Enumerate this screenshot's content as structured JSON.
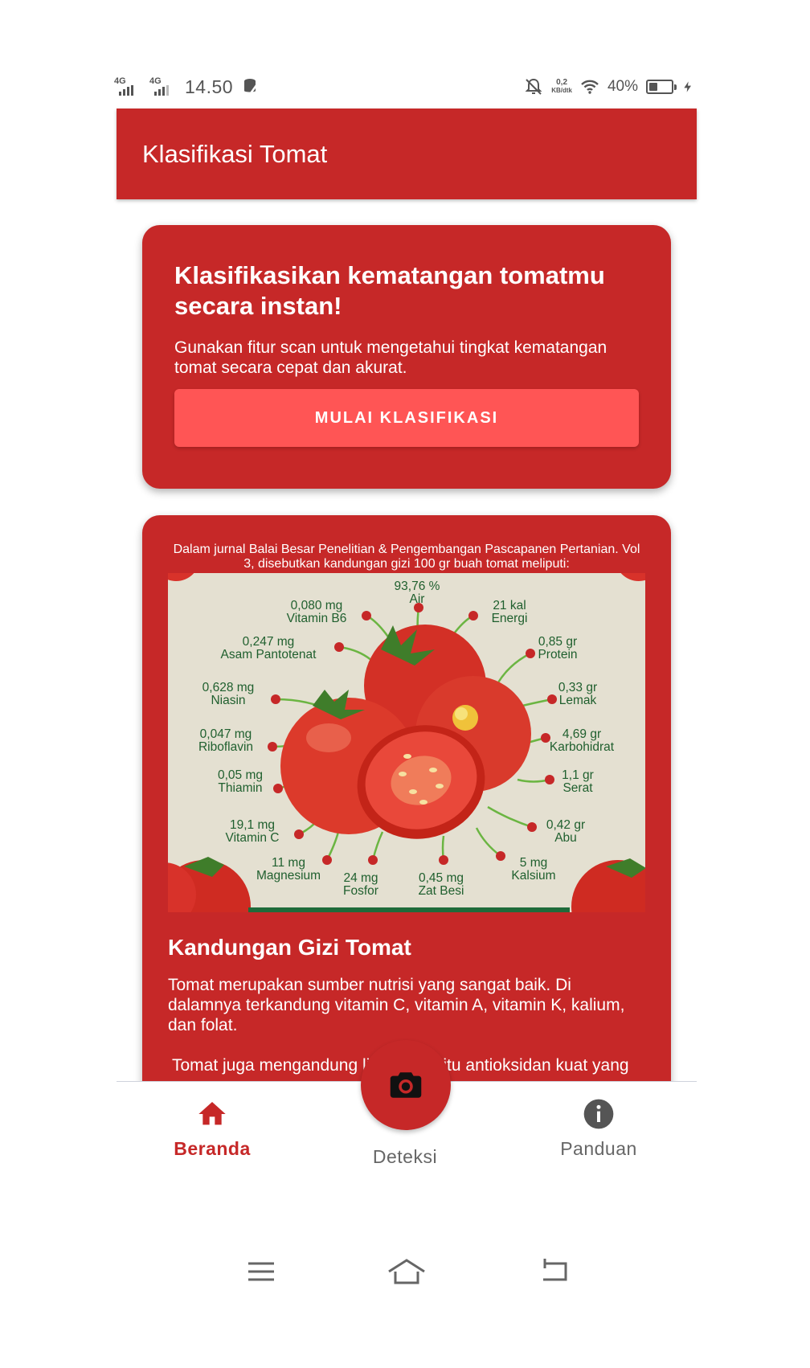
{
  "status_bar": {
    "network1": "4G",
    "network2": "4G",
    "time": "14.50",
    "speed_value": "0,2",
    "speed_unit": "KB/dtk",
    "battery_percent": "40%",
    "battery_level": 0.4
  },
  "app_bar": {
    "title": "Klasifikasi Tomat"
  },
  "hero": {
    "title": "Klasifikasikan kematangan tomatmu secara instan!",
    "subtitle": "Gunakan fitur scan untuk mengetahui tingkat kematangan tomat secara cepat dan akurat.",
    "button_label": "MULAI KLASIFIKASI"
  },
  "nutrition": {
    "banner": "Dalam jurnal Balai Besar Penelitian & Pengembangan Pascapanen Pertanian. Vol 3, disebutkan kandungan gizi 100 gr buah tomat meliputi:",
    "items": [
      {
        "amount": "93,76 %",
        "name": "Air"
      },
      {
        "amount": "0,080 mg",
        "name": "Vitamin B6"
      },
      {
        "amount": "21 kal",
        "name": "Energi"
      },
      {
        "amount": "0,247 mg",
        "name": "Asam Pantotenat"
      },
      {
        "amount": "0,85 gr",
        "name": "Protein"
      },
      {
        "amount": "0,628 mg",
        "name": "Niasin"
      },
      {
        "amount": "0,33 gr",
        "name": "Lemak"
      },
      {
        "amount": "0,047 mg",
        "name": "Riboflavin"
      },
      {
        "amount": "4,69 gr",
        "name": "Karbohidrat"
      },
      {
        "amount": "0,05 mg",
        "name": "Thiamin"
      },
      {
        "amount": "1,1 gr",
        "name": "Serat"
      },
      {
        "amount": "19,1 mg",
        "name": "Vitamin C"
      },
      {
        "amount": "0,42 gr",
        "name": "Abu"
      },
      {
        "amount": "11 mg",
        "name": "Magnesium"
      },
      {
        "amount": "5 mg",
        "name": "Kalsium"
      },
      {
        "amount": "24 mg",
        "name": "Fosfor"
      },
      {
        "amount": "0,45 mg",
        "name": "Zat Besi"
      }
    ],
    "title": "Kandungan Gizi Tomat",
    "paragraph1": "Tomat merupakan sumber nutrisi yang sangat baik. Di dalamnya terkandung vitamin C, vitamin A, vitamin K, kalium, dan folat.",
    "paragraph2": "Tomat juga mengandung likopen, yaitu antioksidan kuat yang"
  },
  "bottom_nav": {
    "home_label": "Beranda",
    "detect_label": "Deteksi",
    "guide_label": "Panduan"
  },
  "colors": {
    "primary": "#c62828",
    "button": "#ff5555",
    "background": "#ffffff",
    "nutrient_text": "#1f5f2e"
  }
}
